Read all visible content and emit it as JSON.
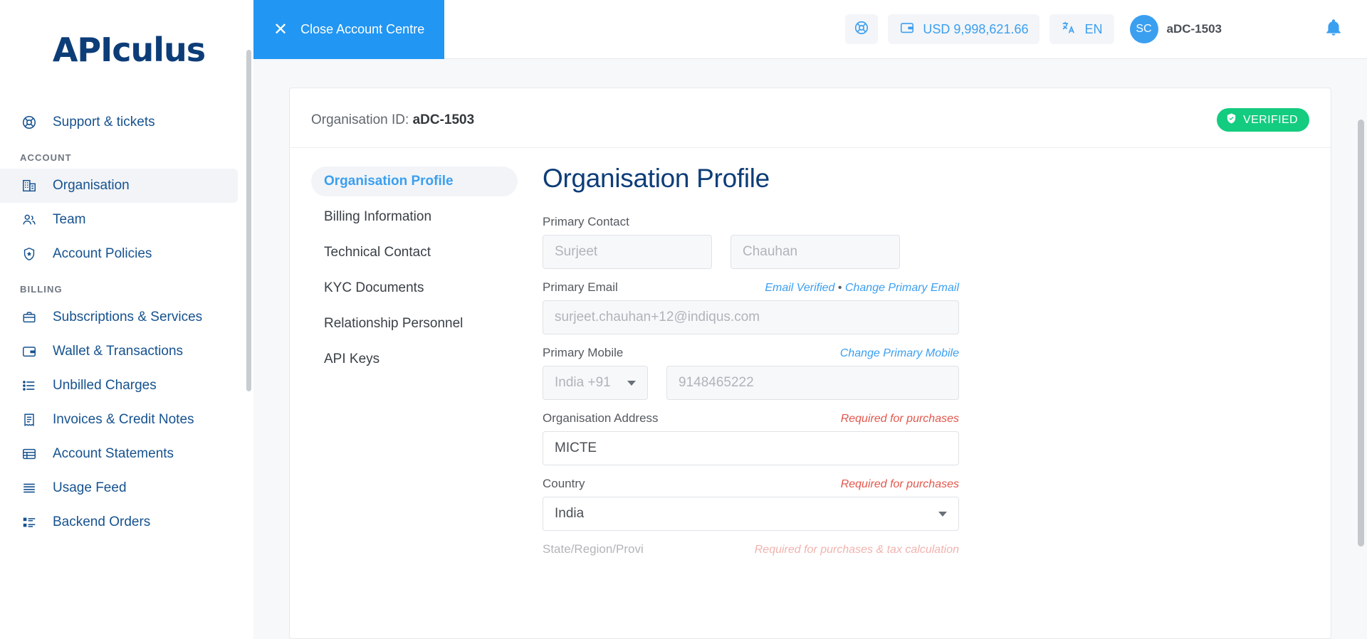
{
  "brand": {
    "logo_text": "APIculus"
  },
  "sidebar": {
    "top_items": [
      {
        "label": "Support & tickets",
        "icon": "lifebuoy-icon"
      }
    ],
    "sections": [
      {
        "title": "ACCOUNT",
        "items": [
          {
            "label": "Organisation",
            "icon": "building-icon",
            "active": true
          },
          {
            "label": "Team",
            "icon": "people-icon",
            "active": false
          },
          {
            "label": "Account Policies",
            "icon": "shield-star-icon",
            "active": false
          }
        ]
      },
      {
        "title": "BILLING",
        "items": [
          {
            "label": "Subscriptions & Services",
            "icon": "briefcase-icon",
            "active": false
          },
          {
            "label": "Wallet & Transactions",
            "icon": "wallet-icon",
            "active": false
          },
          {
            "label": "Unbilled Charges",
            "icon": "list-icon",
            "active": false
          },
          {
            "label": "Invoices & Credit Notes",
            "icon": "receipt-icon",
            "active": false
          },
          {
            "label": "Account Statements",
            "icon": "table-icon",
            "active": false
          },
          {
            "label": "Usage Feed",
            "icon": "lines-icon",
            "active": false
          },
          {
            "label": "Backend Orders",
            "icon": "order-list-icon",
            "active": false
          }
        ]
      }
    ]
  },
  "topbar": {
    "close_button": {
      "label": "Close Account Centre",
      "icon": "close-icon"
    },
    "support_icon": "lifebuoy-icon",
    "wallet": {
      "icon": "wallet-icon",
      "amount": "USD 9,998,621.66"
    },
    "language": {
      "icon": "translate-icon",
      "value": "EN"
    },
    "user": {
      "initials": "SC",
      "name": "aDC-1503"
    },
    "notification_icon": "bell-icon"
  },
  "card": {
    "org_id_label": "Organisation ID:",
    "org_id_value": "aDC-1503",
    "status_badge": {
      "label": "VERIFIED",
      "icon": "shield-check-icon",
      "color": "#13cc7f"
    }
  },
  "tabs": [
    {
      "label": "Organisation Profile",
      "active": true
    },
    {
      "label": "Billing Information",
      "active": false
    },
    {
      "label": "Technical Contact",
      "active": false
    },
    {
      "label": "KYC Documents",
      "active": false
    },
    {
      "label": "Relationship Personnel",
      "active": false
    },
    {
      "label": "API Keys",
      "active": false
    }
  ],
  "form": {
    "title": "Organisation Profile",
    "primary_contact": {
      "label": "Primary Contact",
      "first_name_placeholder": "Surjeet",
      "last_name_placeholder": "Chauhan"
    },
    "primary_email": {
      "label": "Primary Email",
      "verified_text": "Email Verified",
      "separator": "•",
      "change_link": "Change Primary Email",
      "placeholder": "surjeet.chauhan+12@indiqus.com"
    },
    "primary_mobile": {
      "label": "Primary Mobile",
      "change_link": "Change Primary Mobile",
      "country_code": "India +91",
      "number_placeholder": "9148465222"
    },
    "organisation_address": {
      "label": "Organisation Address",
      "hint": "Required for purchases",
      "value": "MICTE"
    },
    "country": {
      "label": "Country",
      "hint": "Required for purchases",
      "value": "India"
    },
    "state": {
      "label": "State/Region/Provi",
      "hint": "Required for purchases & tax calculation"
    }
  }
}
